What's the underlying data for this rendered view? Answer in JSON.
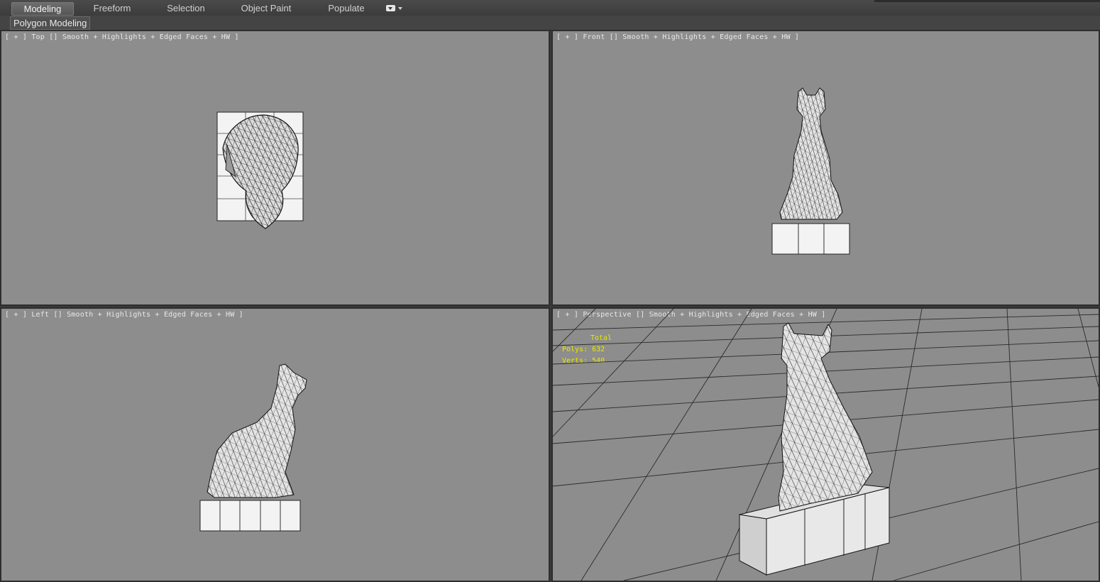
{
  "ribbon": {
    "tabs": [
      {
        "label": "Modeling",
        "active": true
      },
      {
        "label": "Freeform",
        "active": false
      },
      {
        "label": "Selection",
        "active": false
      },
      {
        "label": "Object Paint",
        "active": false
      },
      {
        "label": "Populate",
        "active": false
      }
    ],
    "dropdown_icon": "dropdown-icon"
  },
  "subbar": {
    "panel_label": "Polygon Modeling"
  },
  "viewports": {
    "top": {
      "label": "[ + ] Top [] Smooth + Highlights + Edged Faces + HW ]"
    },
    "front": {
      "label": "[ + ] Front [] Smooth + Highlights + Edged Faces + HW ]"
    },
    "left": {
      "label": "[ + ] Left [] Smooth + Highlights + Edged Faces + HW ]"
    },
    "perspective": {
      "label": "[ + ] Perspective [] Smooth + Highlights + Edged Faces + HW ]",
      "stats": {
        "total": "Total",
        "polys": "Polys: 632",
        "verts": "Verts: 540"
      }
    }
  },
  "colors": {
    "viewport_bg": "#8d8d8d",
    "stats_text": "#e8e800",
    "ribbon_bg": "#3c3c3c"
  }
}
